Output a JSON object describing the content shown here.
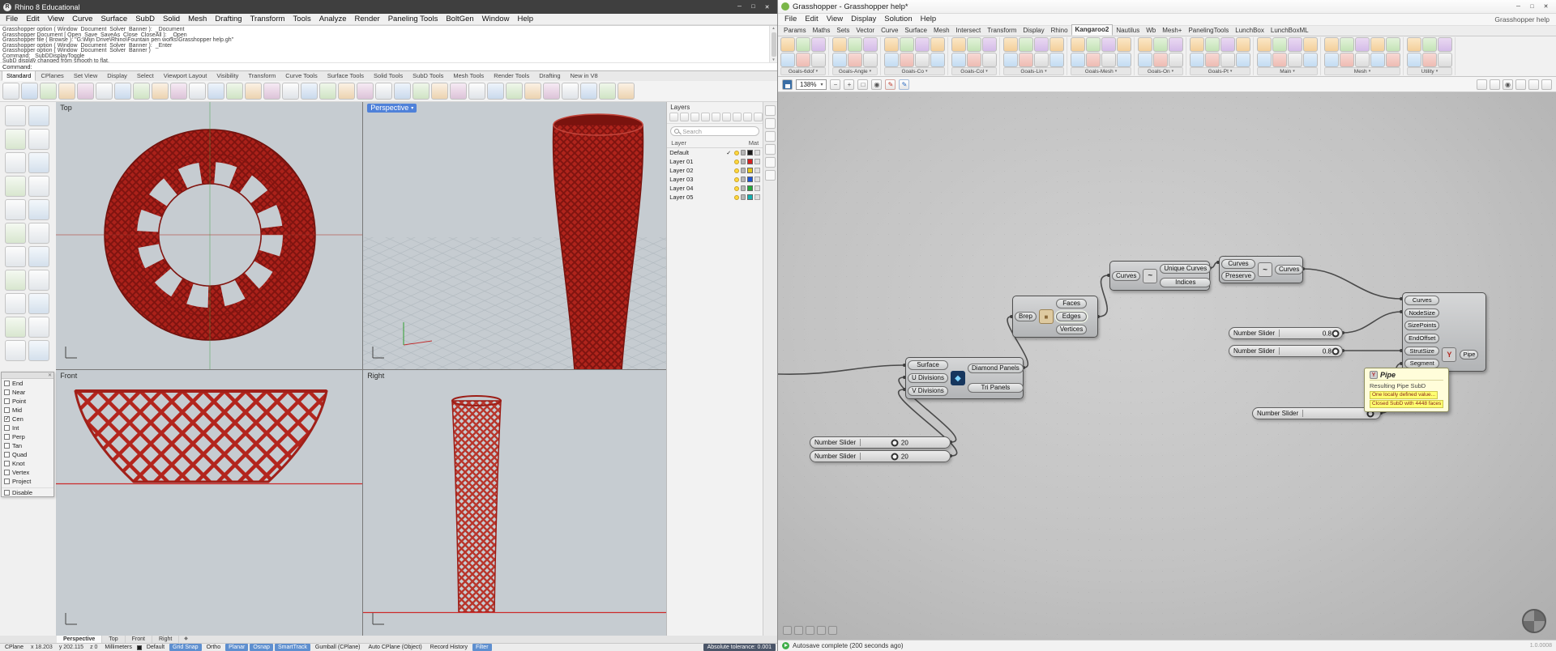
{
  "rhino": {
    "title": "Rhino 8 Educational",
    "menus": [
      "File",
      "Edit",
      "View",
      "Curve",
      "Surface",
      "SubD",
      "Solid",
      "Mesh",
      "Drafting",
      "Transform",
      "Tools",
      "Analyze",
      "Render",
      "Paneling Tools",
      "BoltGen",
      "Window",
      "Help"
    ],
    "command_history": [
      "Grasshopper option ( Window  Document  Solver  Banner ):  _Document",
      "Grasshopper Document [ Open  Save  SaveAs  Close  CloseAll ):  _Open",
      "Grasshopper file ( Browse ): \"G:\\Mijn Drive\\Rhino\\Fountain pen works\\Grasshopper help.gh\"",
      "Grasshopper option ( Window  Document  Solver  Banner ):  _Enter",
      "Grasshopper option ( Window  Document  Solver  Banner )",
      "Command: _SubDDisplayToggle",
      "SubD display changed from smooth to flat."
    ],
    "command_prompt": "Command:",
    "toolbar_tabs": [
      {
        "label": "Standard",
        "active": true
      },
      {
        "label": "CPlanes"
      },
      {
        "label": "Set View"
      },
      {
        "label": "Display"
      },
      {
        "label": "Select"
      },
      {
        "label": "Viewport Layout"
      },
      {
        "label": "Visibility"
      },
      {
        "label": "Transform"
      },
      {
        "label": "Curve Tools"
      },
      {
        "label": "Surface Tools"
      },
      {
        "label": "Solid Tools"
      },
      {
        "label": "SubD Tools"
      },
      {
        "label": "Mesh Tools"
      },
      {
        "label": "Render Tools"
      },
      {
        "label": "Drafting"
      },
      {
        "label": "New in V8"
      }
    ],
    "toolbar_icon_count": 34,
    "palette_icon_count": 22,
    "side_tab_count": 6,
    "viewports": [
      {
        "label": "Top"
      },
      {
        "label": "Perspective",
        "active": true
      },
      {
        "label": "Front"
      },
      {
        "label": "Right"
      }
    ],
    "viewport_tabs": [
      {
        "label": "Perspective",
        "active": true
      },
      {
        "label": "Top"
      },
      {
        "label": "Front"
      },
      {
        "label": "Right"
      }
    ],
    "layers_panel": {
      "title": "Layers",
      "toolbar_icon_count": 9,
      "search_placeholder": "Search",
      "columns": [
        "Layer",
        "Mat"
      ],
      "layers": [
        {
          "name": "Default",
          "current": true,
          "color": "#1a1a1a"
        },
        {
          "name": "Layer 01",
          "color": "#d42222"
        },
        {
          "name": "Layer 02",
          "color": "#e2c51b"
        },
        {
          "name": "Layer 03",
          "color": "#1b54d4"
        },
        {
          "name": "Layer 04",
          "color": "#23a83c"
        },
        {
          "name": "Layer 05",
          "color": "#14b0b0"
        }
      ]
    },
    "osnap_panel": {
      "items": [
        {
          "label": "End"
        },
        {
          "label": "Near"
        },
        {
          "label": "Point"
        },
        {
          "label": "Mid"
        },
        {
          "label": "Cen",
          "checked": true
        },
        {
          "label": "Int"
        },
        {
          "label": "Perp"
        },
        {
          "label": "Tan"
        },
        {
          "label": "Quad"
        },
        {
          "label": "Knot"
        },
        {
          "label": "Vertex"
        },
        {
          "label": "Project"
        }
      ],
      "disable_label": "Disable"
    },
    "status_bar": {
      "cplane": "CPlane",
      "x": "x 18.203",
      "y": "y 202.115",
      "z": "z 0",
      "units": "Millimeters",
      "active_layer": "Default",
      "toggles": [
        {
          "label": "Grid Snap",
          "on": true
        },
        {
          "label": "Ortho"
        },
        {
          "label": "Planar",
          "on": true
        },
        {
          "label": "Osnap",
          "on": true
        },
        {
          "label": "SmartTrack",
          "on": true
        },
        {
          "label": "Gumball (CPlane)"
        },
        {
          "label": "Auto CPlane (Object)"
        },
        {
          "label": "Record History"
        },
        {
          "label": "Filter",
          "on": true
        }
      ],
      "tolerance": "Absolute tolerance: 0.001"
    }
  },
  "grasshopper": {
    "title": "Grasshopper - Grasshopper help*",
    "menus": [
      "File",
      "Edit",
      "View",
      "Display",
      "Solution",
      "Help"
    ],
    "doc_label": "Grasshopper help",
    "tabs": [
      {
        "label": "Params"
      },
      {
        "label": "Maths"
      },
      {
        "label": "Sets"
      },
      {
        "label": "Vector"
      },
      {
        "label": "Curve"
      },
      {
        "label": "Surface"
      },
      {
        "label": "Mesh"
      },
      {
        "label": "Intersect"
      },
      {
        "label": "Transform"
      },
      {
        "label": "Display"
      },
      {
        "label": "Rhino"
      },
      {
        "label": "Kangaroo2",
        "active": true
      },
      {
        "label": "Nautilus"
      },
      {
        "label": "Wb"
      },
      {
        "label": "Mesh+"
      },
      {
        "label": "PanelingTools"
      },
      {
        "label": "LunchBox"
      },
      {
        "label": "LunchBoxML"
      }
    ],
    "ribbon_groups": [
      {
        "label": "Goals-6dof",
        "icons": 6
      },
      {
        "label": "Goals-Angle",
        "icons": 6
      },
      {
        "label": "Goals-Co",
        "icons": 8
      },
      {
        "label": "Goals-Col",
        "icons": 6
      },
      {
        "label": "Goals-Lin",
        "icons": 8
      },
      {
        "label": "Goals-Mesh",
        "icons": 8
      },
      {
        "label": "Goals-On",
        "icons": 6
      },
      {
        "label": "Goals-Pt",
        "icons": 8
      },
      {
        "label": "Main",
        "icons": 8
      },
      {
        "label": "Mesh",
        "icons": 10
      },
      {
        "label": "Utility",
        "icons": 6
      }
    ],
    "canvas_toolbar": {
      "zoom": "138%"
    },
    "canvas_widget_count": 5,
    "nodes": {
      "panels": {
        "inputs": [
          "Surface",
          "U Divisions",
          "V Divisions"
        ],
        "outputs": [
          "Diamond Panels",
          "Tri Panels"
        ]
      },
      "brep": {
        "input": "Brep",
        "outputs": [
          "Faces",
          "Edges",
          "Vertices"
        ]
      },
      "unique": {
        "input": "Curves",
        "outputs": [
          "Unique Curves",
          "Indices"
        ]
      },
      "preserve": {
        "inputs": [
          "Curves",
          "Preserve"
        ],
        "output": "Curves"
      },
      "pipe": {
        "inputs": [
          "Curves",
          "NodeSize",
          "SizePoints",
          "EndOffset",
          "StrutSize",
          "Segment"
        ],
        "output": "Pipe"
      }
    },
    "sliders": [
      {
        "label": "Number Slider",
        "value": "0.8"
      },
      {
        "label": "Number Slider",
        "value": "0.8"
      },
      {
        "label": "Number Slider",
        "value": "20"
      },
      {
        "label": "Number Slider",
        "value": "20"
      },
      {
        "label": "Number Slider",
        "value": ""
      }
    ],
    "tooltip": {
      "title": "Pipe",
      "subtitle": "Resulting Pipe SubD",
      "lines": [
        "One locally defined value...",
        "Closed SubD with 4448 faces"
      ]
    },
    "status": "Autosave complete (200 seconds ago)",
    "version": "1.0.0008"
  }
}
